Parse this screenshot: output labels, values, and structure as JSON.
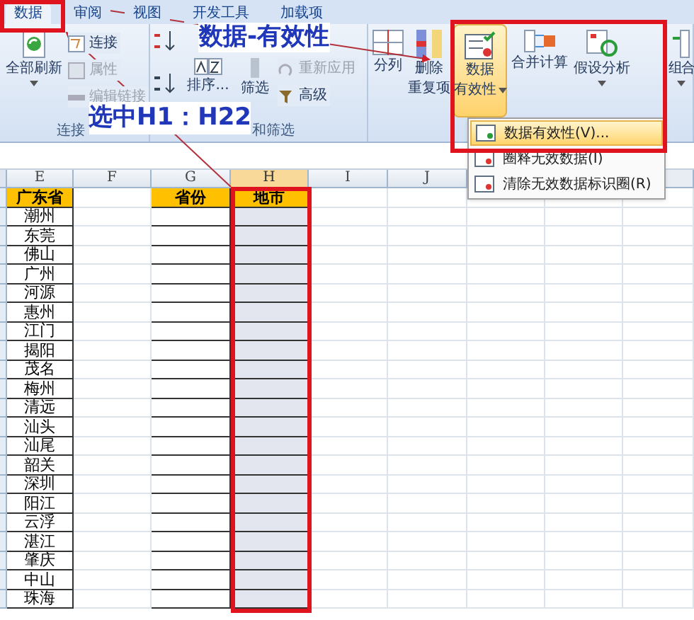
{
  "tabs": [
    {
      "label": "数据",
      "selected": true
    },
    {
      "label": "审阅",
      "selected": false
    },
    {
      "label": "视图",
      "selected": false
    },
    {
      "label": "开发工具",
      "selected": false
    },
    {
      "label": "加载项",
      "selected": false
    }
  ],
  "ribbon": {
    "groups": [
      {
        "label": "连接",
        "items": [
          {
            "kind": "large",
            "lines": [
              "全部刷新"
            ],
            "disabled": false,
            "active": false,
            "dropdown": true
          },
          {
            "kind": "small",
            "label": "连接",
            "disabled": false
          },
          {
            "kind": "small",
            "label": "属性",
            "disabled": true
          },
          {
            "kind": "small",
            "label": "编辑链接",
            "disabled": true
          }
        ]
      },
      {
        "label": "和筛选",
        "items": [
          {
            "kind": "sort",
            "disabled": false
          },
          {
            "kind": "large",
            "lines": [
              "排序..."
            ],
            "disabled": false,
            "active": false,
            "dropdown": false
          },
          {
            "kind": "large",
            "lines": [
              "筛选"
            ],
            "disabled": false,
            "active": false,
            "dropdown": false
          },
          {
            "kind": "small",
            "label": "重新应用",
            "disabled": true
          },
          {
            "kind": "small",
            "label": "高级",
            "disabled": false
          }
        ]
      },
      {
        "items": [
          {
            "kind": "large",
            "lines": [
              "分列"
            ],
            "disabled": false,
            "active": false,
            "dropdown": false
          },
          {
            "kind": "large",
            "lines": [
              "删除",
              "重复项"
            ],
            "disabled": false,
            "active": false,
            "dropdown": false
          },
          {
            "kind": "large",
            "lines": [
              "数据",
              "有效性"
            ],
            "disabled": false,
            "active": true,
            "dropdown": true
          },
          {
            "kind": "large",
            "lines": [
              "合并计算"
            ],
            "disabled": false,
            "active": false,
            "dropdown": false
          },
          {
            "kind": "large",
            "lines": [
              "假设分析"
            ],
            "disabled": false,
            "active": false,
            "dropdown": true
          },
          {
            "kind": "large",
            "lines": [
              "组合"
            ],
            "disabled": false,
            "active": false,
            "dropdown": true
          }
        ]
      }
    ]
  },
  "menu": {
    "items": [
      {
        "label": "数据有效性(V)...",
        "selected": true
      },
      {
        "label": "圈释无效数据(I)",
        "selected": false
      },
      {
        "label": "清除无效数据标识圈(R)",
        "selected": false
      }
    ]
  },
  "sheet": {
    "columns": [
      {
        "letter": "E",
        "selected": false
      },
      {
        "letter": "F",
        "selected": false
      },
      {
        "letter": "G",
        "selected": false
      },
      {
        "letter": "H",
        "selected": true
      },
      {
        "letter": "I",
        "selected": false
      },
      {
        "letter": "J",
        "selected": false
      }
    ],
    "header_row": {
      "E": "广东省",
      "G": "省份",
      "H": "地市"
    },
    "cities": [
      "潮州",
      "东莞",
      "佛山",
      "广州",
      "河源",
      "惠州",
      "江门",
      "揭阳",
      "茂名",
      "梅州",
      "清远",
      "汕头",
      "汕尾",
      "韶关",
      "深圳",
      "阳江",
      "云浮",
      "湛江",
      "肇庆",
      "中山",
      "珠海"
    ]
  },
  "callouts": [
    {
      "text": "数据-有效性"
    },
    {
      "text": "选中H1：H22"
    }
  ]
}
